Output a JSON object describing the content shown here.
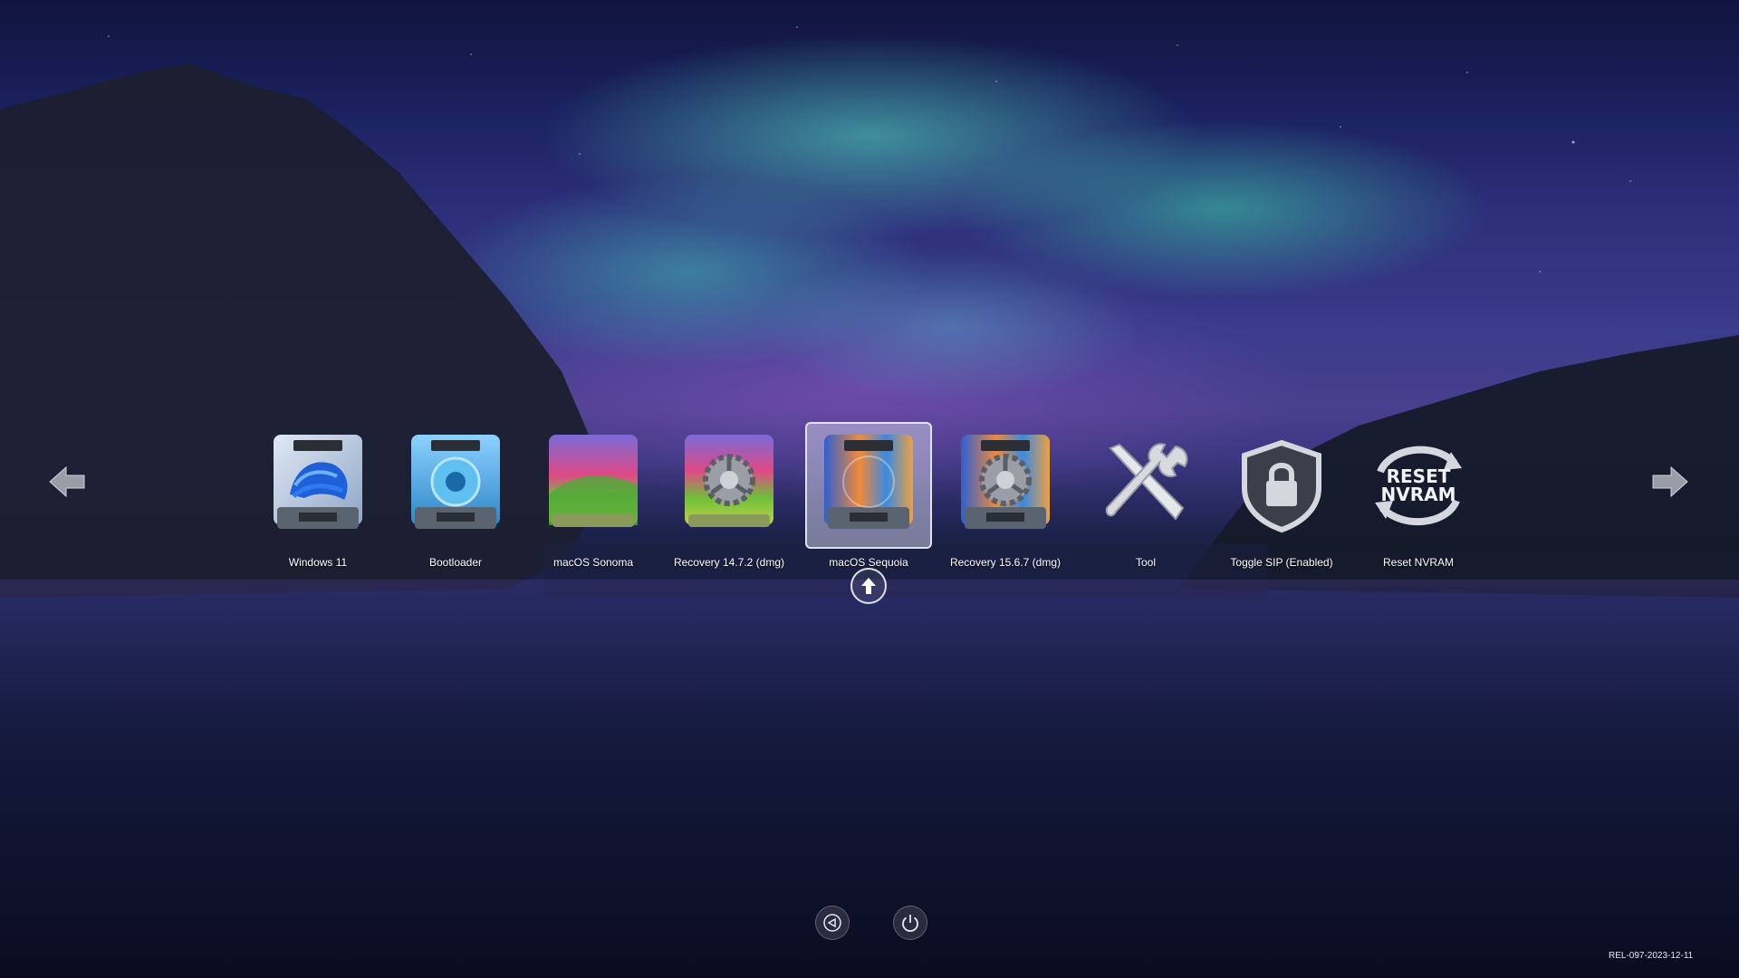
{
  "colors": {
    "accent_selection": "#c8c8e1",
    "label_text": "#ffffff"
  },
  "navigation": {
    "left_icon": "arrow-left-icon",
    "right_icon": "arrow-right-icon"
  },
  "entries": [
    {
      "label": "Windows 11",
      "icon": "windows-drive-icon",
      "selected": false
    },
    {
      "label": "Bootloader",
      "icon": "bootloader-drive-icon",
      "selected": false
    },
    {
      "label": "macOS Sonoma",
      "icon": "sonoma-drive-icon",
      "selected": false
    },
    {
      "label": "Recovery 14.7.2 (dmg)",
      "icon": "recovery-sonoma-drive-icon",
      "selected": false
    },
    {
      "label": "macOS Sequoia",
      "icon": "sequoia-drive-icon",
      "selected": true
    },
    {
      "label": "Recovery 15.6.7 (dmg)",
      "icon": "recovery-sequoia-drive-icon",
      "selected": false
    },
    {
      "label": "Tool",
      "icon": "wrench-screwdriver-icon",
      "selected": false
    },
    {
      "label": "Toggle SIP (Enabled)",
      "icon": "shield-lock-icon",
      "selected": false
    },
    {
      "label": "Reset NVRAM",
      "icon": "reset-nvram-icon",
      "selected": false
    }
  ],
  "nvram_icon_text": {
    "line1": "RESET",
    "line2": "NVRAM"
  },
  "bottom_controls": {
    "back_icon": "back-icon",
    "power_icon": "power-icon"
  },
  "version": "REL-097-2023-12-11"
}
